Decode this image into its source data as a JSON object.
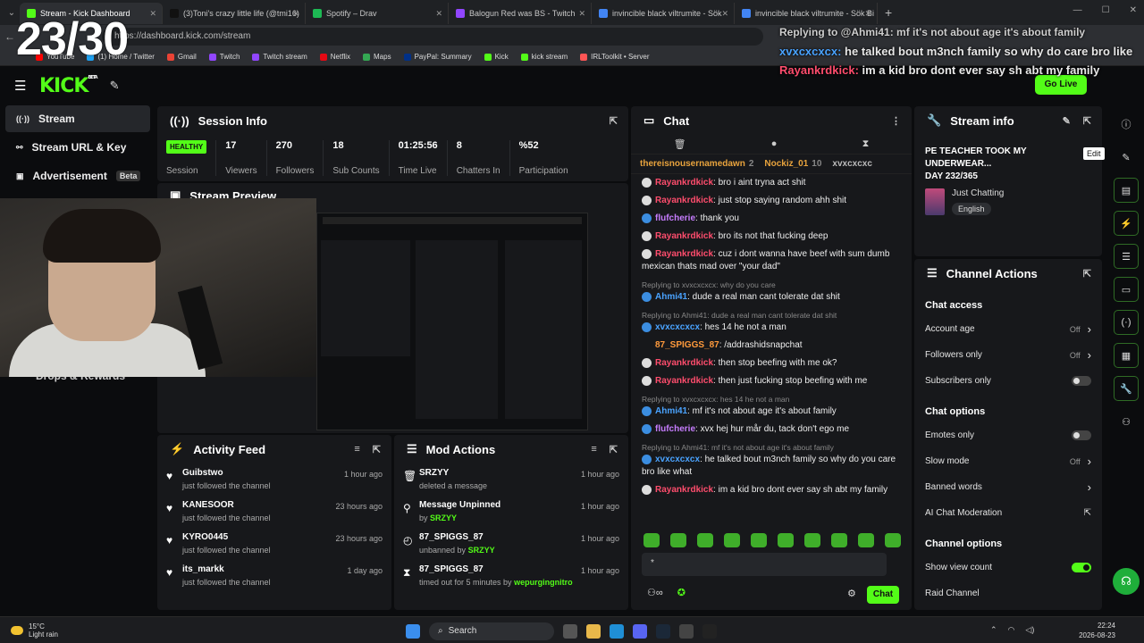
{
  "browser": {
    "tabs": [
      {
        "title": "Stream - Kick Dashboard",
        "color": "#53fc18",
        "active": true
      },
      {
        "title": "(3)Toni's crazy little life (@tmi16)",
        "color": "#111111"
      },
      {
        "title": "Spotify – Drav",
        "color": "#1db954"
      },
      {
        "title": "Balogun Red was BS - Twitch",
        "color": "#9146ff"
      },
      {
        "title": "invincible black viltrumite - Sök",
        "color": "#4285f4"
      },
      {
        "title": "invincible black viltrumite - Sök Bi",
        "color": "#4285f4"
      }
    ],
    "url": "https://dashboard.kick.com/stream",
    "bookmarks": [
      {
        "label": "YouTube",
        "color": "#ff0000"
      },
      {
        "label": "(1) Home / Twitter",
        "color": "#1da1f2"
      },
      {
        "label": "Gmail",
        "color": "#ea4335"
      },
      {
        "label": "Twitch",
        "color": "#9146ff"
      },
      {
        "label": "Twitch stream",
        "color": "#9146ff"
      },
      {
        "label": "Netflix",
        "color": "#e50914"
      },
      {
        "label": "Maps",
        "color": "#34a853"
      },
      {
        "label": "PayPal: Summary",
        "color": "#003087"
      },
      {
        "label": "Kick",
        "color": "#53fc18"
      },
      {
        "label": "kick stream",
        "color": "#53fc18"
      },
      {
        "label": "IRLToolkit • Server",
        "color": "#ff5555"
      }
    ],
    "profile_label": "Chat"
  },
  "counter": "23/30",
  "overlay": {
    "reply": "Replying to @Ahmi41: mf it's not about age it's about family",
    "lines": [
      {
        "user": "xvxcxcxcx",
        "text": " he talked bout m3nch family so why do care bro like"
      },
      {
        "user": "Rayankrdkick",
        "text": " im a kid bro dont ever say sh abt my family"
      }
    ]
  },
  "header": {
    "logo": "KICK",
    "logo_sup": "BETA",
    "go_live": "Go Live"
  },
  "sidebar": {
    "items": [
      {
        "label": "Stream",
        "icon": "broadcast-icon",
        "glyph": "((·))"
      },
      {
        "label": "Stream URL & Key",
        "icon": "link-icon",
        "glyph": "⚯"
      },
      {
        "label": "Advertisement",
        "icon": "ad-icon",
        "glyph": "▣",
        "badge": "Beta"
      }
    ],
    "drops": "Drops & Rewards"
  },
  "session": {
    "title": "Session Info",
    "status": "HEALTHY",
    "stats": [
      {
        "value": "",
        "label": "Session"
      },
      {
        "value": "17",
        "label": "Viewers"
      },
      {
        "value": "270",
        "label": "Followers"
      },
      {
        "value": "18",
        "label": "Sub Counts"
      },
      {
        "value": "01:25:56",
        "label": "Time Live"
      },
      {
        "value": "8",
        "label": "Chatters In"
      },
      {
        "value": "%52",
        "label": "Participation"
      }
    ]
  },
  "preview": {
    "title": "Stream Preview"
  },
  "activity": {
    "title": "Activity Feed",
    "items": [
      {
        "name": "Guibstwo",
        "sub": "just followed the channel",
        "time": "1 hour ago"
      },
      {
        "name": "KANESOOR",
        "sub": "just followed the channel",
        "time": "23 hours ago"
      },
      {
        "name": "KYRO0445",
        "sub": "just followed the channel",
        "time": "23 hours ago"
      },
      {
        "name": "its_markk",
        "sub": "just followed the channel",
        "time": "1 day ago"
      }
    ]
  },
  "mod": {
    "title": "Mod Actions",
    "items": [
      {
        "name": "SRZYY",
        "sub": "deleted a message",
        "by": "",
        "time": "1 hour ago",
        "glyph": "🗑"
      },
      {
        "name": "Message Unpinned",
        "sub": "by",
        "by": "SRZYY",
        "time": "1 hour ago",
        "glyph": "⚲"
      },
      {
        "name": "87_SPIGGS_87",
        "sub": "unbanned by",
        "by": "SRZYY",
        "time": "1 hour ago",
        "glyph": "◴"
      },
      {
        "name": "87_SPIGGS_87",
        "sub": "timed out for 5 minutes by",
        "by": "wepurgingnitro",
        "time": "1 hour ago",
        "glyph": "⧗"
      }
    ]
  },
  "chat": {
    "title": "Chat",
    "pinned": [
      {
        "user": "thereisnousernamedawn",
        "count": "2"
      },
      {
        "user": "Nockiz_01",
        "count": "10"
      },
      {
        "user": "xvxcxcxc",
        "count": ""
      }
    ],
    "messages": [
      {
        "reply": "",
        "user": "Rayankrdkick",
        "color": "#ff4d6d",
        "text": ": bro i aint tryna act shit"
      },
      {
        "reply": "",
        "user": "Rayankrdkick",
        "color": "#ff4d6d",
        "text": ": just stop saying random ahh shit"
      },
      {
        "reply": "",
        "user": "flufcherie",
        "color": "#c77dff",
        "text": ": thank you"
      },
      {
        "reply": "",
        "user": "Rayankrdkick",
        "color": "#ff4d6d",
        "text": ": bro its not that fucking deep"
      },
      {
        "reply": "",
        "user": "Rayankrdkick",
        "color": "#ff4d6d",
        "text": ": cuz i dont wanna have beef with sum dumb mexican thats mad over \"your dad\""
      },
      {
        "reply": "Replying to xvxcxcxcx: why do you care",
        "user": "Ahmi41",
        "color": "#4aa3ff",
        "text": ": dude a real man cant tolerate dat shit"
      },
      {
        "reply": "Replying to Ahmi41: dude a real man cant tolerate dat shit",
        "user": "xvxcxcxcx",
        "color": "#4aa3ff",
        "text": ": hes 14 he not a man"
      },
      {
        "reply": "",
        "user": "87_SPIGGS_87",
        "color": "#ff9a3c",
        "text": ": /addrashidsnapchat"
      },
      {
        "reply": "",
        "user": "Rayankrdkick",
        "color": "#ff4d6d",
        "text": ": then stop beefing with me ok?"
      },
      {
        "reply": "",
        "user": "Rayankrdkick",
        "color": "#ff4d6d",
        "text": ": then just fucking stop beefing with me"
      },
      {
        "reply": "Replying to xvxcxcxcx: hes 14 he not a man",
        "user": "Ahmi41",
        "color": "#4aa3ff",
        "text": ": mf it's not about age it's about family"
      },
      {
        "reply": "",
        "user": "flufcherie",
        "color": "#c77dff",
        "text": ": xvx hej hur mår du, tack don't ego me"
      },
      {
        "reply": "Replying to Ahmi41: mf it's not about age it's about family",
        "user": "xvxcxcxcx",
        "color": "#4aa3ff",
        "text": ": he talked bout m3nch family so why do you care bro like what"
      },
      {
        "reply": "",
        "user": "Rayankrdkick",
        "color": "#ff4d6d",
        "text": ": im a kid bro dont ever say sh abt my family"
      }
    ],
    "input_value": "*",
    "send_label": "Chat"
  },
  "stream_info": {
    "title": "Stream info",
    "stream_title": "PE TEACHER TOOK MY UNDERWEAR...",
    "day": "DAY 232/365",
    "category": "Just Chatting",
    "language": "English",
    "tooltip": "Edit"
  },
  "channel_actions": {
    "title": "Channel Actions",
    "sections": [
      {
        "heading": "Chat access",
        "rows": [
          {
            "label": "Account age",
            "value": "Off",
            "kind": "select"
          },
          {
            "label": "Followers only",
            "value": "Off",
            "kind": "select"
          },
          {
            "label": "Subscribers only",
            "value": "",
            "kind": "toggle-off"
          }
        ]
      },
      {
        "heading": "Chat options",
        "rows": [
          {
            "label": "Emotes only",
            "value": "",
            "kind": "toggle-off"
          },
          {
            "label": "Slow mode",
            "value": "Off",
            "kind": "select"
          },
          {
            "label": "Banned words",
            "value": "",
            "kind": "select"
          },
          {
            "label": "AI Chat Moderation",
            "value": "",
            "kind": "external"
          }
        ]
      },
      {
        "heading": "Channel options",
        "rows": [
          {
            "label": "Show view count",
            "value": "",
            "kind": "toggle-on"
          },
          {
            "label": "Raid Channel",
            "value": "",
            "kind": "none"
          }
        ]
      }
    ]
  },
  "taskbar": {
    "temp": "15°C",
    "weather": "Light rain",
    "search": "Search",
    "time": "22:24",
    "date": "2026-08-23"
  }
}
